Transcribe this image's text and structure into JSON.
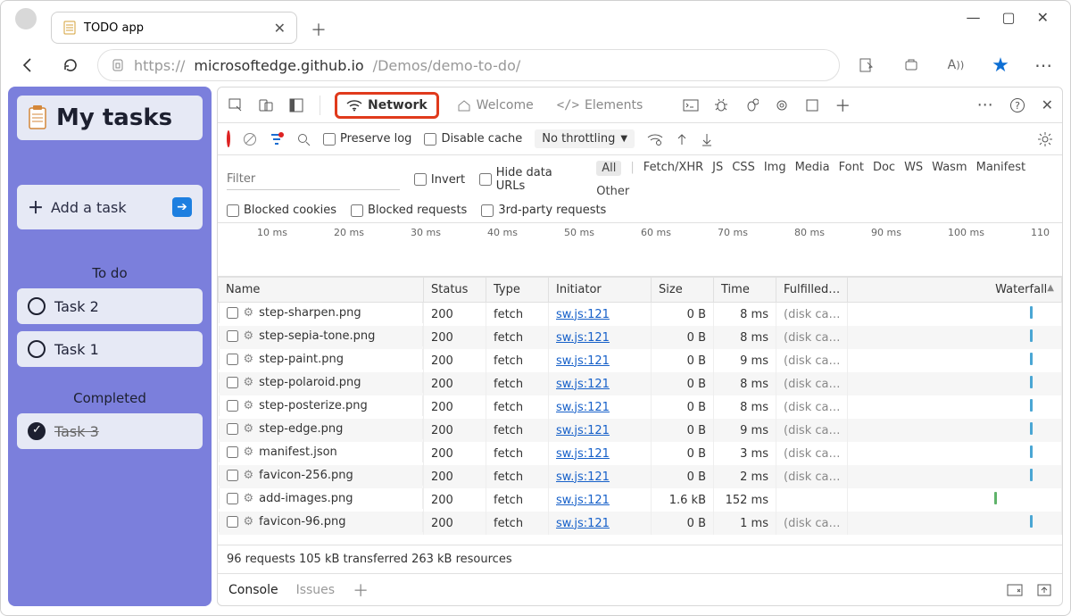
{
  "browser": {
    "tab_title": "TODO app",
    "url_host": "microsoftedge.github.io",
    "url_path": "/Demos/demo-to-do/",
    "url_scheme": "https://"
  },
  "app": {
    "title": "My tasks",
    "add_placeholder": "Add a task",
    "section_todo": "To do",
    "section_done": "Completed",
    "tasks_todo": [
      "Task 2",
      "Task 1"
    ],
    "tasks_done": [
      "Task 3"
    ]
  },
  "devtools": {
    "tabs": {
      "network": "Network",
      "welcome": "Welcome",
      "elements": "Elements"
    },
    "toolbar": {
      "preserve_log": "Preserve log",
      "disable_cache": "Disable cache",
      "throttling": "No throttling"
    },
    "filters": {
      "placeholder": "Filter",
      "invert": "Invert",
      "hide_data_urls": "Hide data URLs",
      "types": [
        "All",
        "Fetch/XHR",
        "JS",
        "CSS",
        "Img",
        "Media",
        "Font",
        "Doc",
        "WS",
        "Wasm",
        "Manifest",
        "Other"
      ],
      "blocked_cookies": "Blocked cookies",
      "blocked_requests": "Blocked requests",
      "third_party": "3rd-party requests"
    },
    "timeline_ticks": [
      "10 ms",
      "20 ms",
      "30 ms",
      "40 ms",
      "50 ms",
      "60 ms",
      "70 ms",
      "80 ms",
      "90 ms",
      "100 ms",
      "110"
    ],
    "columns": [
      "Name",
      "Status",
      "Type",
      "Initiator",
      "Size",
      "Time",
      "Fulfilled…",
      "Waterfall"
    ],
    "rows": [
      {
        "name": "step-sharpen.png",
        "status": "200",
        "type": "fetch",
        "initiator": "sw.js:121",
        "size": "0 B",
        "time": "8 ms",
        "cache": "(disk ca…"
      },
      {
        "name": "step-sepia-tone.png",
        "status": "200",
        "type": "fetch",
        "initiator": "sw.js:121",
        "size": "0 B",
        "time": "8 ms",
        "cache": "(disk ca…"
      },
      {
        "name": "step-paint.png",
        "status": "200",
        "type": "fetch",
        "initiator": "sw.js:121",
        "size": "0 B",
        "time": "9 ms",
        "cache": "(disk ca…"
      },
      {
        "name": "step-polaroid.png",
        "status": "200",
        "type": "fetch",
        "initiator": "sw.js:121",
        "size": "0 B",
        "time": "8 ms",
        "cache": "(disk ca…"
      },
      {
        "name": "step-posterize.png",
        "status": "200",
        "type": "fetch",
        "initiator": "sw.js:121",
        "size": "0 B",
        "time": "8 ms",
        "cache": "(disk ca…"
      },
      {
        "name": "step-edge.png",
        "status": "200",
        "type": "fetch",
        "initiator": "sw.js:121",
        "size": "0 B",
        "time": "9 ms",
        "cache": "(disk ca…"
      },
      {
        "name": "manifest.json",
        "status": "200",
        "type": "fetch",
        "initiator": "sw.js:121",
        "size": "0 B",
        "time": "3 ms",
        "cache": "(disk ca…"
      },
      {
        "name": "favicon-256.png",
        "status": "200",
        "type": "fetch",
        "initiator": "sw.js:121",
        "size": "0 B",
        "time": "2 ms",
        "cache": "(disk ca…"
      },
      {
        "name": "add-images.png",
        "status": "200",
        "type": "fetch",
        "initiator": "sw.js:121",
        "size": "1.6 kB",
        "time": "152 ms",
        "cache": ""
      },
      {
        "name": "favicon-96.png",
        "status": "200",
        "type": "fetch",
        "initiator": "sw.js:121",
        "size": "0 B",
        "time": "1 ms",
        "cache": "(disk ca…"
      }
    ],
    "summary": "96 requests   105 kB transferred   263 kB resources",
    "drawer": {
      "console": "Console",
      "issues": "Issues"
    }
  }
}
